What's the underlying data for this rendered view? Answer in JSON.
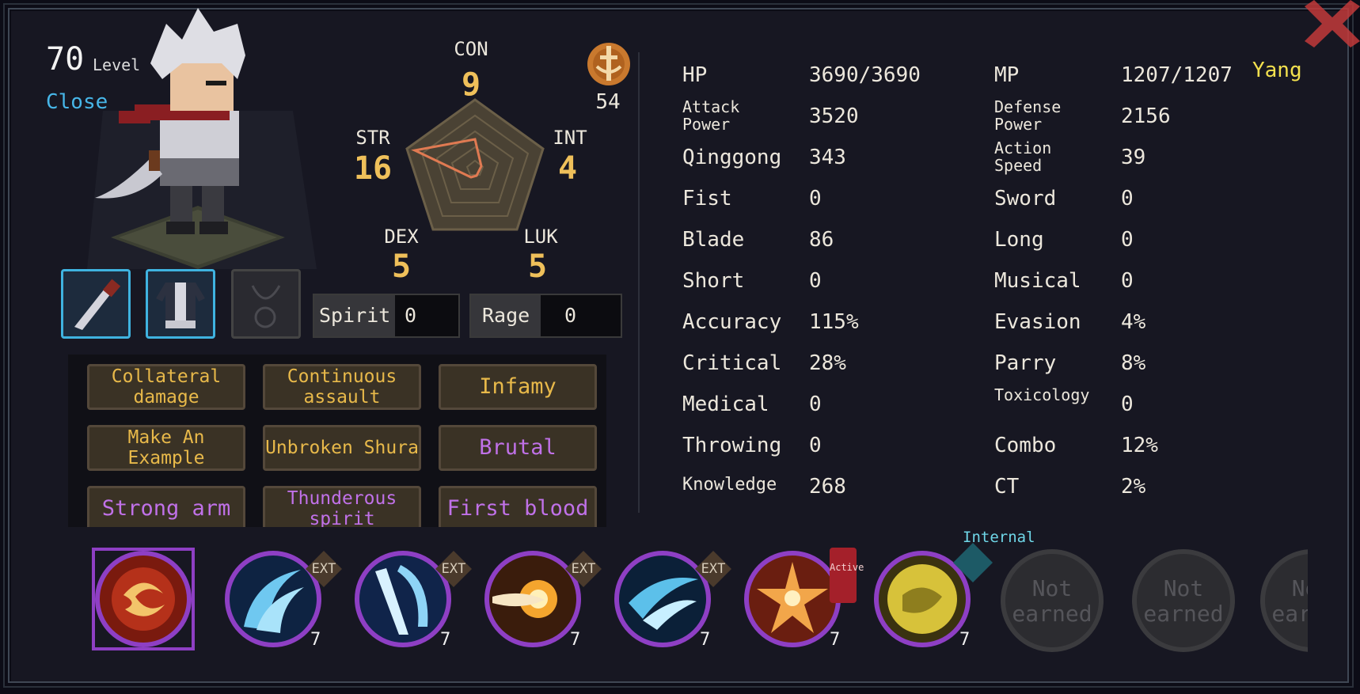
{
  "header": {
    "level_number": "70",
    "level_label": "Level",
    "close_label": "Close",
    "currency_label": "Yang"
  },
  "attributes": {
    "con": {
      "label": "CON",
      "value": "9"
    },
    "str": {
      "label": "STR",
      "value": "16"
    },
    "int": {
      "label": "INT",
      "value": "4"
    },
    "dex": {
      "label": "DEX",
      "value": "5"
    },
    "luk": {
      "label": "LUK",
      "value": "5"
    }
  },
  "token": {
    "value": "54"
  },
  "meters": {
    "spirit": {
      "label": "Spirit",
      "value": "0"
    },
    "rage": {
      "label": "Rage",
      "value": "0"
    }
  },
  "traits": [
    {
      "label": "Collateral damage",
      "color": "gold"
    },
    {
      "label": "Continuous assault",
      "color": "gold"
    },
    {
      "label": "Infamy",
      "color": "gold"
    },
    {
      "label": "Make An Example",
      "color": "gold"
    },
    {
      "label": "Unbroken Shura",
      "color": "gold"
    },
    {
      "label": "Brutal",
      "color": "purple"
    },
    {
      "label": "Strong arm",
      "color": "purple"
    },
    {
      "label": "Thunderous spirit",
      "color": "purple"
    },
    {
      "label": "First blood",
      "color": "purple"
    }
  ],
  "stats_left": [
    {
      "label": "HP",
      "value": "3690/3690"
    },
    {
      "label": "Attack Power",
      "value": "3520"
    },
    {
      "label": "Qinggong",
      "value": "343"
    },
    {
      "label": "Fist",
      "value": "0"
    },
    {
      "label": "Blade",
      "value": "86"
    },
    {
      "label": "Short",
      "value": "0"
    },
    {
      "label": "Accuracy",
      "value": "115%"
    },
    {
      "label": "Critical",
      "value": "28%"
    },
    {
      "label": "Medical",
      "value": "0"
    },
    {
      "label": "Throwing",
      "value": "0"
    },
    {
      "label": "Knowledge",
      "value": "268"
    }
  ],
  "stats_right": [
    {
      "label": "MP",
      "value": "1207/1207"
    },
    {
      "label": "Defense Power",
      "value": "2156"
    },
    {
      "label": "Action Speed",
      "value": "39"
    },
    {
      "label": "Sword",
      "value": "0"
    },
    {
      "label": "Long",
      "value": "0"
    },
    {
      "label": "Musical",
      "value": "0"
    },
    {
      "label": "Evasion",
      "value": "4%"
    },
    {
      "label": "Parry",
      "value": "8%"
    },
    {
      "label": "Toxicology",
      "value": "0"
    },
    {
      "label": "Combo",
      "value": "12%"
    },
    {
      "label": "CT",
      "value": "2%"
    }
  ],
  "skills": [
    {
      "name": "fire-vortex-skill-icon",
      "level": "",
      "tag": ""
    },
    {
      "name": "ice-wave-skill-icon",
      "level": "7",
      "tag": "EXT"
    },
    {
      "name": "ice-slash-skill-icon",
      "level": "7",
      "tag": "EXT"
    },
    {
      "name": "fire-burst-skill-icon",
      "level": "7",
      "tag": "EXT"
    },
    {
      "name": "wind-slash-skill-icon",
      "level": "7",
      "tag": "EXT"
    },
    {
      "name": "flame-star-skill-icon",
      "level": "7",
      "tag": "Active"
    },
    {
      "name": "golden-orb-skill-icon",
      "level": "7",
      "tag": "Internal"
    }
  ],
  "skill_tags": {
    "active": "Active",
    "internal": "Internal"
  },
  "locked_skills": [
    "Not earned",
    "Not earned",
    "Not earned"
  ],
  "colors": {
    "gold": "#e8b94a",
    "purple": "#c071e8",
    "accent": "#3fb3e0",
    "yang": "#f2e04e"
  }
}
